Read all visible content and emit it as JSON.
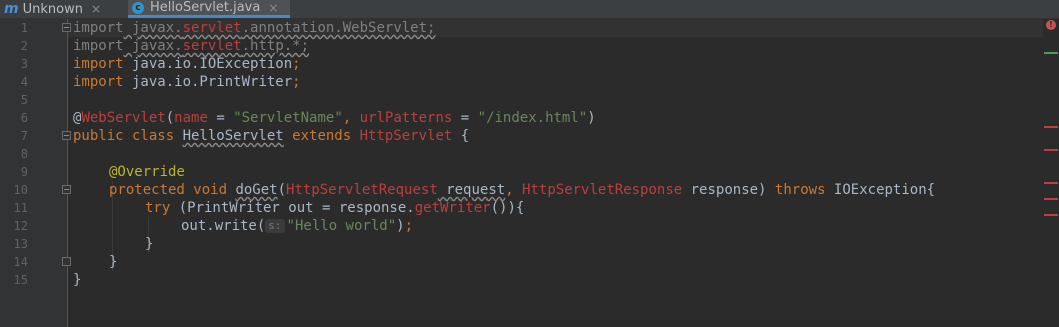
{
  "tabs": [
    {
      "icon": "m",
      "label": "Unknown",
      "close": "×",
      "active": false
    },
    {
      "icon": "c",
      "label": "HelloServlet.java",
      "close": "×",
      "active": true
    }
  ],
  "line_numbers": [
    "1",
    "2",
    "3",
    "4",
    "5",
    "6",
    "7",
    "8",
    "9",
    "10",
    "11",
    "12",
    "13",
    "14",
    "15"
  ],
  "code": {
    "l1": {
      "kw": "import",
      "pkg": " javax.",
      "servlet": "servlet",
      "rest": ".annotation.WebServlet;"
    },
    "l2": {
      "kw": "import",
      "pkg": " javax.",
      "servlet": "servlet",
      "rest": ".http.*;"
    },
    "l3": {
      "kw": "import",
      "rest": " java.io.IOException",
      "semi": ";"
    },
    "l4": {
      "kw": "import",
      "rest": " java.io.PrintWriter",
      "semi": ";"
    },
    "l6": {
      "at": "@",
      "ann": "WebServlet",
      "open": "(",
      "p1": "name",
      "eq1": " = ",
      "s1": "\"ServletName\"",
      "comma": ", ",
      "p2": "urlPatterns",
      "eq2": " = ",
      "s2": "\"/index.html\"",
      "close": ")"
    },
    "l7": {
      "kw1": "public class ",
      "cls": "HelloServlet",
      "kw2": " extends ",
      "sup": "HttpServlet",
      "brace": " {"
    },
    "l9": {
      "ann": "@Override"
    },
    "l10": {
      "kw": "protected void ",
      "m": "doGet",
      "open": "(",
      "t1": "HttpServletRequest",
      "p1": " request",
      "comma": ", ",
      "t2": "HttpServletResponse",
      "p2": " response) ",
      "kw2": "throws",
      "exc": " IOException{"
    },
    "l11": {
      "kw": "try ",
      "a": "(PrintWriter out = response.",
      "m": "getWriter",
      "b": "()){"
    },
    "l12": {
      "a": "out.write(",
      "hint": "s:",
      "s": "\"Hello world\"",
      "b": ")",
      "semi": ";"
    },
    "l13": {
      "t": "}"
    },
    "l14": {
      "t": "}"
    },
    "l15": {
      "t": "}"
    }
  },
  "error_indicator": "!",
  "colors": {
    "background": "#2b2b2b",
    "keyword": "#cc7832",
    "string": "#6a8759",
    "annotation": "#bbb529",
    "error": "#bc3f3c"
  }
}
